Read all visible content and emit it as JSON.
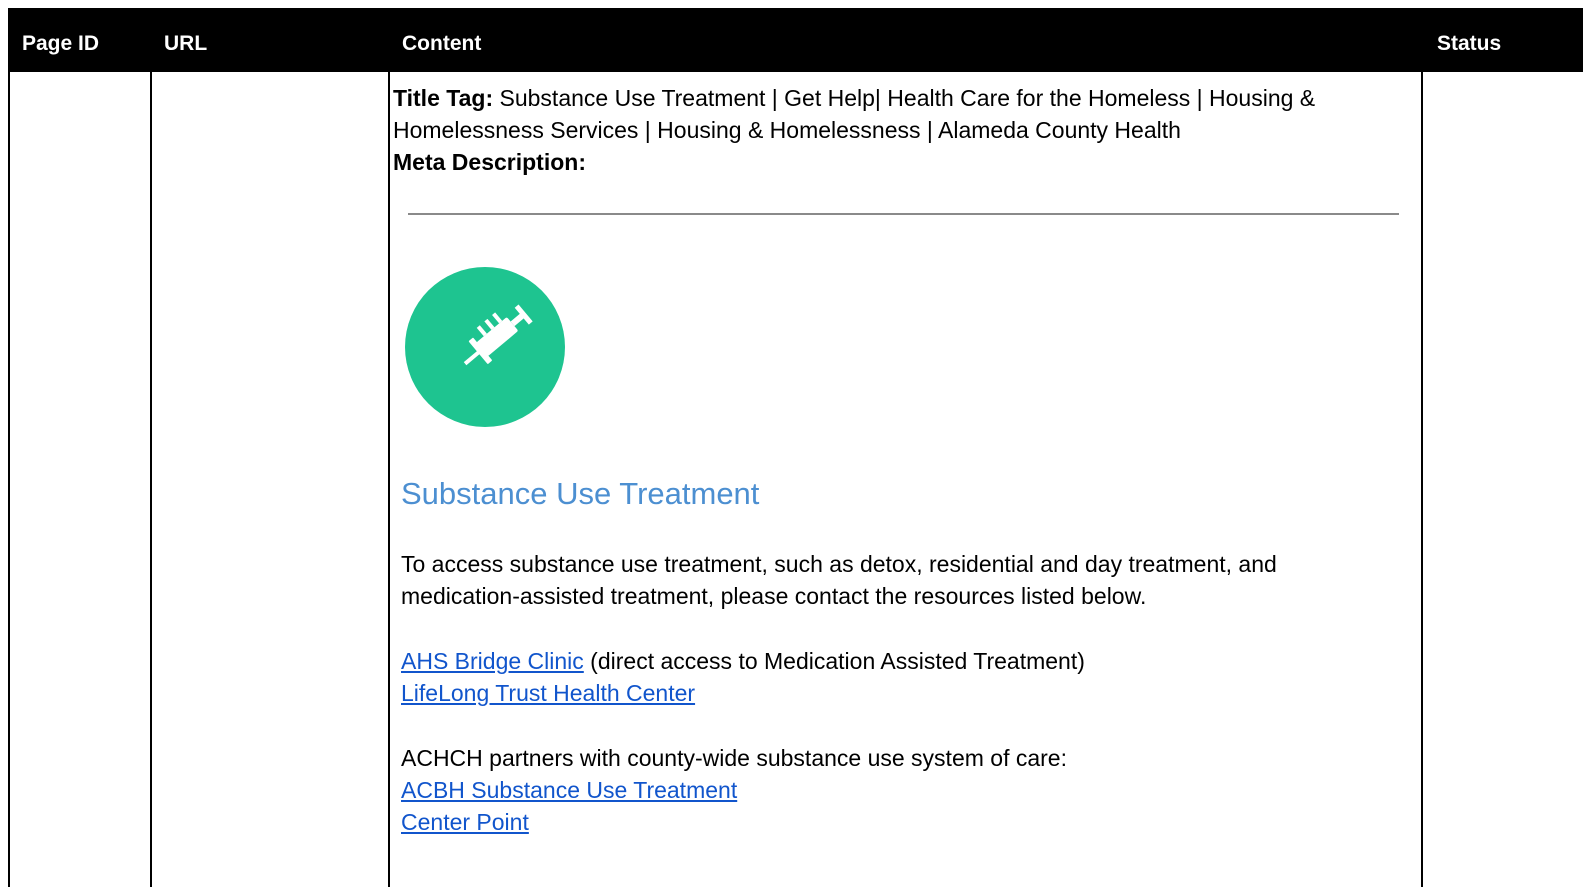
{
  "table": {
    "headers": {
      "page_id": "Page ID",
      "url": "URL",
      "content": "Content",
      "status": "Status"
    }
  },
  "meta": {
    "title_tag_label": "Title Tag:",
    "title_tag_value": " Substance Use Treatment | Get Help| Health Care for the Homeless | Housing & Homelessness Services | Housing & Homelessness | Alameda County Health",
    "meta_description_label": "Meta Description:"
  },
  "page": {
    "icon": "syringe-icon",
    "icon_color": "#1ec490",
    "heading": "Substance Use Treatment",
    "heading_color": "#4c8fd1",
    "intro": "To access substance use treatment, such as detox, residential and day treatment, and medication-assisted treatment, please contact the resources listed below.",
    "link1": "AHS Bridge Clinic",
    "link1_note": " (direct access to Medication Assisted Treatment)",
    "link2": "LifeLong Trust Health Center",
    "partners_text": "ACHCH partners with county-wide substance use system of care:",
    "link3": "ACBH Substance Use Treatment",
    "link4": "Center Point",
    "link_color": "#1155cc"
  }
}
